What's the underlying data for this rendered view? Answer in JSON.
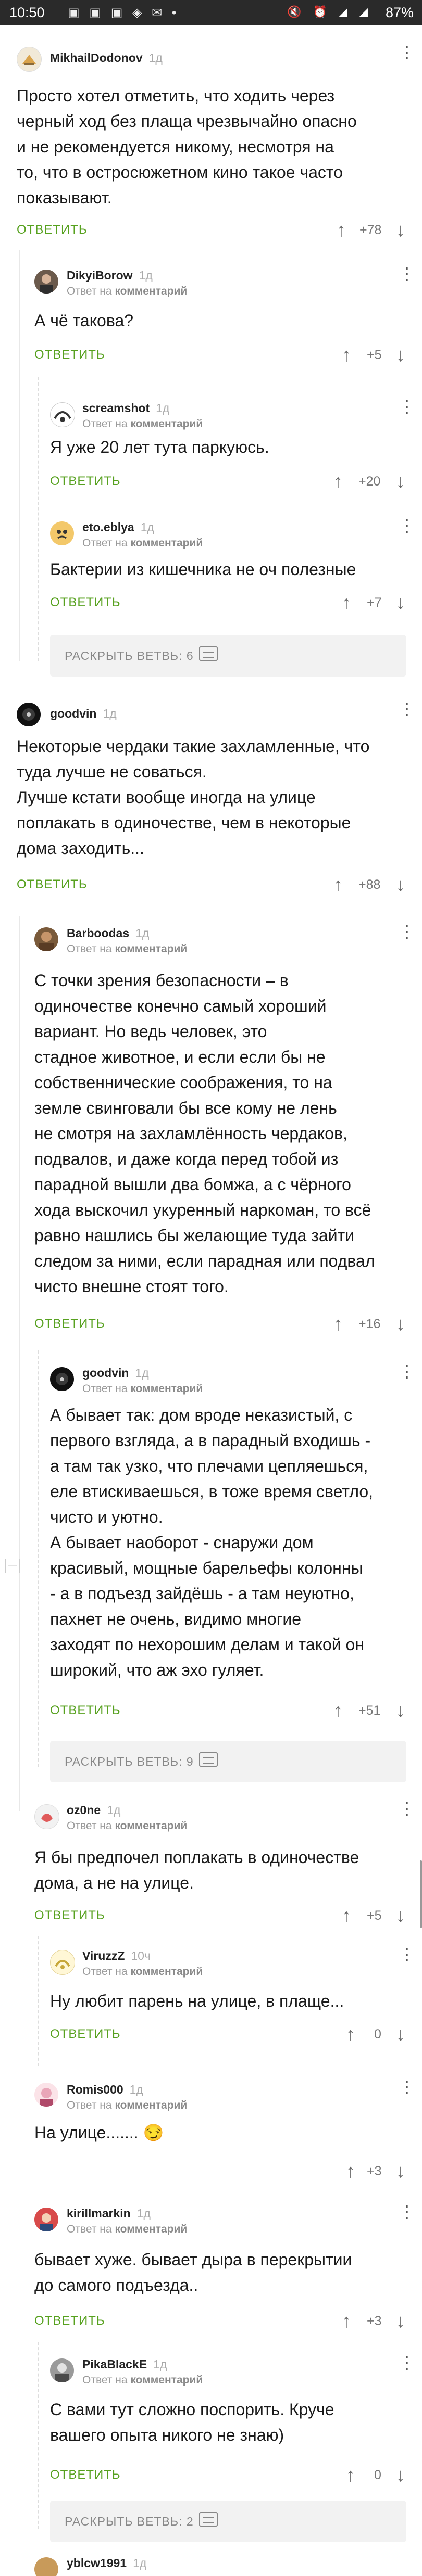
{
  "status": {
    "time": "10:50",
    "battery": "87%"
  },
  "ui": {
    "reply": "ОТВЕТИТЬ",
    "reply_to": "Ответ на",
    "reply_target": "комментарий",
    "expand_label": "РАСКРЫТЬ ВЕТВЬ:"
  },
  "comments": [
    {
      "user": "MikhailDodonov",
      "age": "1д",
      "text": "Просто хотел отметить, что ходить через\nчерный ход без плаща чрезвычайно опасно\nи не рекомендуется никому, несмотря на\nто, что в остросюжетном кино такое часто\nпоказывают.",
      "score": "+78"
    },
    {
      "user": "DikyiBorow",
      "age": "1д",
      "text": "А чё такова?",
      "score": "+5"
    },
    {
      "user": "screamshot",
      "age": "1д",
      "text": "Я уже 20 лет тута паркуюсь.",
      "score": "+20"
    },
    {
      "user": "eto.eblya",
      "age": "1д",
      "text": "Бактерии из кишечника не оч полезные",
      "score": "+7"
    },
    {
      "user": "goodvin",
      "age": "1д",
      "text": "Некоторые чердаки такие захламленные, что\nтуда лучше не соваться.\nЛучше кстати вообще иногда на улице\nпоплакать в одиночестве, чем в некоторые\nдома заходить...",
      "score": "+88"
    },
    {
      "user": "Barboodas",
      "age": "1д",
      "text": "С точки зрения безопасности – в\nодиночестве конечно самый хороший\nвариант. Но ведь человек, это\nстадное животное, и если если бы не\nсобственнические соображения, то на\nземле свинговали бы все кому не лень\nне смотря на захламлённость чердаков,\nподвалов, и даже когда перед тобой из\nпарадной вышли два бомжа, а с чёрного\nхода выскочил укуренный наркоман, то всё\nравно нашлись бы желающие туда зайти\nследом за ними, если парадная или подвал\nчисто внешне стоят того.",
      "score": "+16"
    },
    {
      "user": "goodvin",
      "age": "1д",
      "text": "А бывает так: дом вроде неказистый, с\nпервого взгляда, а в парадный входишь -\nа там так узко, что плечами цепляешься,\nеле втискиваешься, в тоже время светло,\nчисто и уютно.\nА бывает наоборот - снаружи дом\nкрасивый, мощные барельефы  колонны\n- а в подъезд зайдёшь - а там неуютно,\nпахнет не очень, видимо многие\nзаходят по нехорошим делам и такой он\nширокий, что аж эхо гуляет.",
      "score": "+51"
    },
    {
      "user": "oz0ne",
      "age": "1д",
      "text": "Я бы предпочел поплакать в одиночестве\nдома, а не на улице.",
      "score": "+5"
    },
    {
      "user": "ViruzzZ",
      "age": "10ч",
      "text": "Ну любит парень на улице, в плаще...",
      "score": "0"
    },
    {
      "user": "Romis000",
      "age": "1д",
      "text": "На улице.......",
      "emoji": "😏",
      "score": "+3"
    },
    {
      "user": "kirillmarkin",
      "age": "1д",
      "text": "бывает хуже. бывает дыра в перекрытии\nдо самого подъезда..",
      "score": "+3"
    },
    {
      "user": "PikaBlackE",
      "age": "1д",
      "text": "С вами тут сложно поспорить. Круче\nвашего опыта никого не знаю)",
      "score": "0"
    },
    {
      "user": "yblcw1991",
      "age": "1д"
    }
  ],
  "expand": [
    "6",
    "9",
    "2"
  ],
  "colors": {
    "accent": "#57a11f",
    "statusbar": "#2a2a2a"
  }
}
